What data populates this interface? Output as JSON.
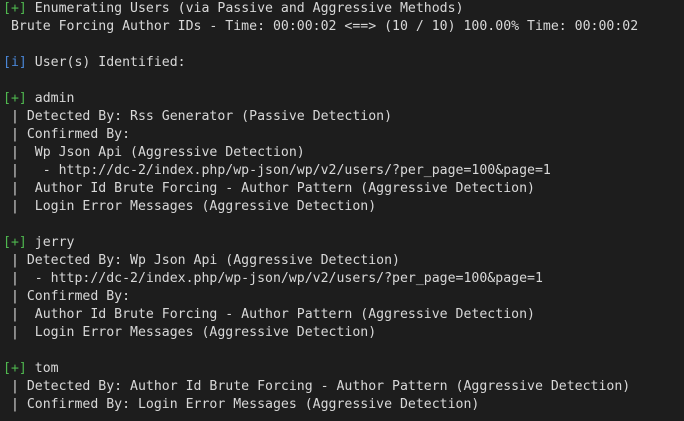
{
  "colors": {
    "background": "#1d1d1d",
    "text": "#d8d8d8",
    "success_tag": "#4fb84f",
    "info_tag": "#4a86d6"
  },
  "lines": [
    {
      "tag": "[+]",
      "tag_type": "success",
      "text": " Enumerating Users (via Passive and Aggressive Methods)"
    },
    {
      "tag": "",
      "tag_type": "",
      "text": " Brute Forcing Author IDs - Time: 00:00:02 <==> (10 / 10) 100.00% Time: 00:00:02"
    },
    {
      "tag": "",
      "tag_type": "",
      "text": ""
    },
    {
      "tag": "[i]",
      "tag_type": "info",
      "text": " User(s) Identified:"
    },
    {
      "tag": "",
      "tag_type": "",
      "text": ""
    },
    {
      "tag": "[+]",
      "tag_type": "success",
      "text": " admin"
    },
    {
      "tag": "",
      "tag_type": "",
      "text": " | Detected By: Rss Generator (Passive Detection)"
    },
    {
      "tag": "",
      "tag_type": "",
      "text": " | Confirmed By:"
    },
    {
      "tag": "",
      "tag_type": "",
      "text": " |  Wp Json Api (Aggressive Detection)"
    },
    {
      "tag": "",
      "tag_type": "",
      "text": " |   - http://dc-2/index.php/wp-json/wp/v2/users/?per_page=100&page=1"
    },
    {
      "tag": "",
      "tag_type": "",
      "text": " |  Author Id Brute Forcing - Author Pattern (Aggressive Detection)"
    },
    {
      "tag": "",
      "tag_type": "",
      "text": " |  Login Error Messages (Aggressive Detection)"
    },
    {
      "tag": "",
      "tag_type": "",
      "text": ""
    },
    {
      "tag": "[+]",
      "tag_type": "success",
      "text": " jerry"
    },
    {
      "tag": "",
      "tag_type": "",
      "text": " | Detected By: Wp Json Api (Aggressive Detection)"
    },
    {
      "tag": "",
      "tag_type": "",
      "text": " |  - http://dc-2/index.php/wp-json/wp/v2/users/?per_page=100&page=1"
    },
    {
      "tag": "",
      "tag_type": "",
      "text": " | Confirmed By:"
    },
    {
      "tag": "",
      "tag_type": "",
      "text": " |  Author Id Brute Forcing - Author Pattern (Aggressive Detection)"
    },
    {
      "tag": "",
      "tag_type": "",
      "text": " |  Login Error Messages (Aggressive Detection)"
    },
    {
      "tag": "",
      "tag_type": "",
      "text": ""
    },
    {
      "tag": "[+]",
      "tag_type": "success",
      "text": " tom"
    },
    {
      "tag": "",
      "tag_type": "",
      "text": " | Detected By: Author Id Brute Forcing - Author Pattern (Aggressive Detection)"
    },
    {
      "tag": "",
      "tag_type": "",
      "text": " | Confirmed By: Login Error Messages (Aggressive Detection)"
    }
  ]
}
